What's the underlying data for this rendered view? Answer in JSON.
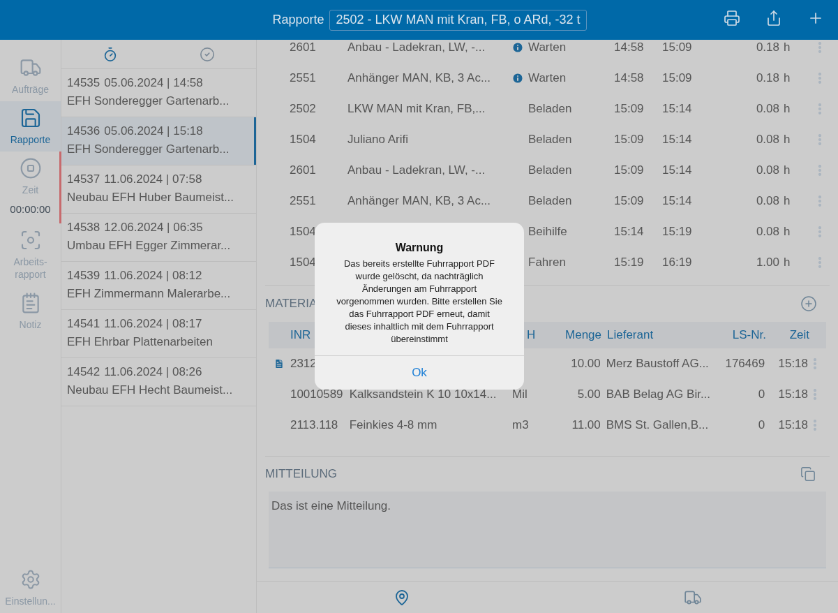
{
  "header": {
    "title": "Rapporte",
    "selector_value": "2502 - LKW MAN mit Kran, FB, o ARd, -32 t"
  },
  "nav": {
    "items": [
      {
        "kind": "orders",
        "label": "Aufträge",
        "selected": false
      },
      {
        "kind": "reports",
        "label": "Rapporte",
        "selected": true
      },
      {
        "kind": "time",
        "label": "Zeit",
        "timer": "00:00:00",
        "selected": false
      },
      {
        "kind": "work",
        "label": "Arbeits-\nrapport",
        "selected": false
      },
      {
        "kind": "note",
        "label": "Notiz",
        "selected": false
      }
    ],
    "settings": {
      "label": "Einstellun..."
    }
  },
  "report_list": {
    "tabs": [
      {
        "kind": "timer",
        "selected": true
      },
      {
        "kind": "done",
        "selected": false
      }
    ],
    "items": [
      {
        "number": "14535",
        "datetime": "05.06.2024 | 14:58",
        "title": "EFH Sonderegger Gartenarb...",
        "selected": false
      },
      {
        "number": "14536",
        "datetime": "05.06.2024 | 15:18",
        "title": "EFH Sonderegger Gartenarb...",
        "selected": true
      },
      {
        "number": "14537",
        "datetime": "11.06.2024 | 07:58",
        "title": "Neubau EFH Huber Baumeist...",
        "selected": false
      },
      {
        "number": "14538",
        "datetime": "12.06.2024 | 06:35",
        "title": "Umbau EFH Egger Zimmerar...",
        "selected": false
      },
      {
        "number": "14539",
        "datetime": "11.06.2024 | 08:12",
        "title": "EFH Zimmermann Malerarbe...",
        "selected": false
      },
      {
        "number": "14541",
        "datetime": "11.06.2024 | 08:17",
        "title": "EFH Ehrbar Plattenarbeiten",
        "selected": false
      },
      {
        "number": "14542",
        "datetime": "11.06.2024 | 08:26",
        "title": "Neubau EFH Hecht Baumeist...",
        "selected": false
      }
    ]
  },
  "activities": [
    {
      "inr": "2601",
      "name": "Anbau - Ladekran, LW, -...",
      "info": true,
      "status": "Warten",
      "from": "14:58",
      "to": "15:09",
      "duration": "0.18",
      "unit": "h"
    },
    {
      "inr": "2551",
      "name": "Anhänger MAN, KB, 3 Ac...",
      "info": true,
      "status": "Warten",
      "from": "14:58",
      "to": "15:09",
      "duration": "0.18",
      "unit": "h"
    },
    {
      "inr": "2502",
      "name": "LKW MAN mit Kran, FB,...",
      "info": false,
      "status": "Beladen",
      "from": "15:09",
      "to": "15:14",
      "duration": "0.08",
      "unit": "h"
    },
    {
      "inr": "1504",
      "name": "Juliano Arifi",
      "info": false,
      "status": "Beladen",
      "from": "15:09",
      "to": "15:14",
      "duration": "0.08",
      "unit": "h"
    },
    {
      "inr": "2601",
      "name": "Anbau - Ladekran, LW, -...",
      "info": false,
      "status": "Beladen",
      "from": "15:09",
      "to": "15:14",
      "duration": "0.08",
      "unit": "h"
    },
    {
      "inr": "2551",
      "name": "Anhänger MAN, KB, 3 Ac...",
      "info": false,
      "status": "Beladen",
      "from": "15:09",
      "to": "15:14",
      "duration": "0.08",
      "unit": "h"
    },
    {
      "inr": "1504",
      "status": "Beihilfe",
      "from": "15:14",
      "to": "15:19",
      "duration": "0.08",
      "unit": "h"
    },
    {
      "inr": "1504",
      "status": "Fahren",
      "from": "15:19",
      "to": "16:19",
      "duration": "1.00",
      "unit": "h"
    }
  ],
  "materials": {
    "title": "MATERIA",
    "columns": {
      "inr": "INR",
      "unit": "H",
      "qty": "Menge",
      "supplier": "Lieferant",
      "ls": "LS-Nr.",
      "time": "Zeit"
    },
    "rows": [
      {
        "inr": "2312",
        "document": true,
        "qty": "10.00",
        "supplier": "Merz Baustoff AG...",
        "ls": "176469",
        "time": "15:18"
      },
      {
        "inr": "10010589",
        "name": "Kalksandstein K 10 10x14...",
        "unit": "Mil",
        "document": false,
        "qty": "5.00",
        "supplier": "BAB Belag AG Bir...",
        "ls": "0",
        "time": "15:18"
      },
      {
        "inr": "2113.118",
        "name": "Feinkies 4-8 mm",
        "unit": "m3",
        "document": false,
        "qty": "11.00",
        "supplier": "BMS St. Gallen,B...",
        "ls": "0",
        "time": "15:18"
      }
    ]
  },
  "message": {
    "title": "MITTEILUNG",
    "value": "Das ist eine Mitteilung."
  },
  "dialog": {
    "title": "Warnung",
    "text": "Das bereits erstellte Fuhrrapport PDF wurde gelöscht, da nachträglich Änderungen am Fuhrrapport vorgenommen wurden. Bitte erstellen Sie das Fuhrrapport PDF erneut, damit dieses inhaltlich mit dem Fuhrrapport übereinstimmt",
    "button": "Ok"
  }
}
